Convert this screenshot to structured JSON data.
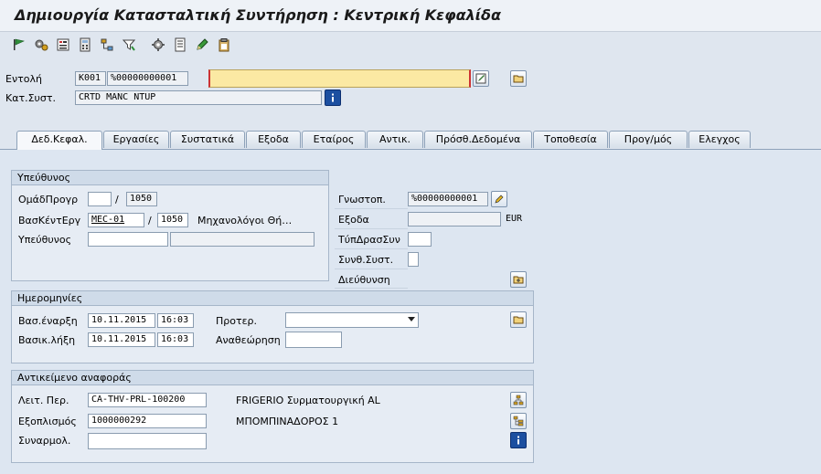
{
  "title": "Δημιουργία Κατασταλτική Συντήρηση : Κεντρική Κεφαλίδα",
  "toolbar": {
    "icons": [
      "flag-icon",
      "gears-icon",
      "list-icon",
      "calculator-icon",
      "hierarchy-icon",
      "filter-icon",
      "settings-icon",
      "document-icon",
      "pen-icon",
      "clipboard-icon"
    ]
  },
  "header": {
    "order_label": "Εντολή",
    "order_type": "K001",
    "order_number": "%00000000001",
    "order_desc": "",
    "syscond_label": "Κατ.Συστ.",
    "syscond_value": "CRTD MANC NTUP"
  },
  "tabs": [
    {
      "label": "Δεδ.Κεφαλ."
    },
    {
      "label": "Εργασίες"
    },
    {
      "label": "Συστατικά"
    },
    {
      "label": "Εξοδα"
    },
    {
      "label": "Εταίρος"
    },
    {
      "label": "Αντικ."
    },
    {
      "label": "Πρόσθ.Δεδομένα"
    },
    {
      "label": "Τοποθεσία"
    },
    {
      "label": "Προγ/μός"
    },
    {
      "label": "Ελεγχος"
    }
  ],
  "responsible": {
    "title": "Υπεύθυνος",
    "plangroup_label": "ΟμάδΠρογρ",
    "plangroup_value": "",
    "plangroup_plant": "1050",
    "workctr_label": "ΒασΚέντΕργ",
    "workctr_value": "MEC-01",
    "workctr_plant": "1050",
    "workctr_desc": "Μηχανολόγοι Θή…",
    "person_label": "Υπεύθυνος",
    "person_value": "",
    "person_name": "",
    "slash": "/"
  },
  "right_block": {
    "notif_label": "Γνωστοπ.",
    "notif_value": "%00000000001",
    "costs_label": "Εξοδα",
    "costs_value": "",
    "currency": "EUR",
    "pmact_label": "ΤύπΔρασΣυν",
    "pmact_value": "",
    "syscond_label": "Συνθ.Συστ.",
    "syscond_value": "",
    "address_label": "Διεύθυνση"
  },
  "dates": {
    "title": "Ημερομηνίες",
    "start_label": "Βασ.έναρξη",
    "start_date": "10.11.2015",
    "start_time": "16:03",
    "end_label": "Βασικ.λήξη",
    "end_date": "10.11.2015",
    "end_time": "16:03",
    "priority_label": "Προτερ.",
    "priority_value": "",
    "revision_label": "Αναθεώρηση",
    "revision_value": ""
  },
  "reference": {
    "title": "Αντικείμενο αναφοράς",
    "funcloc_label": "Λειτ. Περ.",
    "funcloc_value": "CA-THV-PRL-100200",
    "funcloc_desc": "FRIGERIO Συρματουργική AL",
    "equip_label": "Εξοπλισμός",
    "equip_value": "1000000292",
    "equip_desc": "ΜΠΟΜΠΙΝΑΔΟΡΟΣ 1",
    "assembly_label": "Συναρμολ.",
    "assembly_value": ""
  }
}
